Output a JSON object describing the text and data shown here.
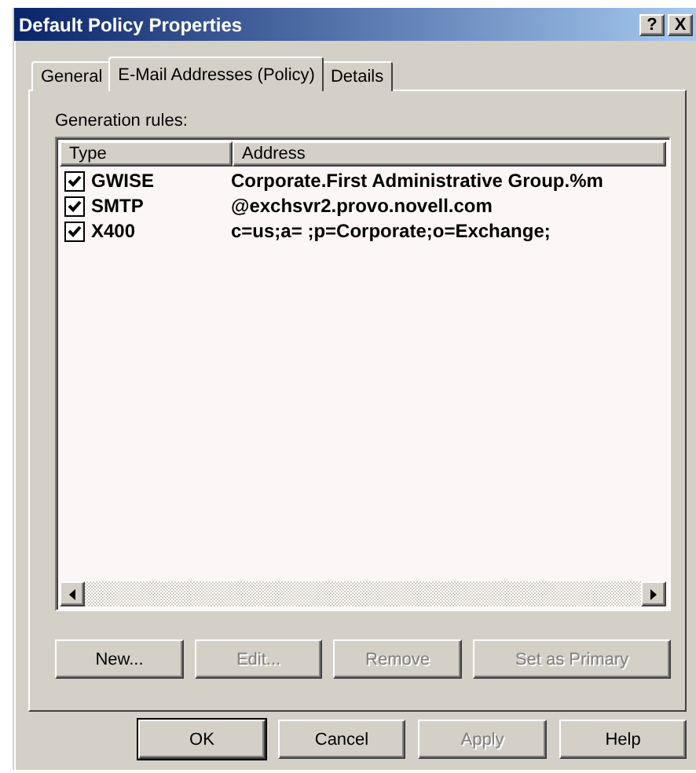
{
  "window": {
    "title": "Default Policy Properties",
    "title_buttons": [
      "?",
      "X"
    ]
  },
  "tabs": [
    {
      "label": "General",
      "selected": false
    },
    {
      "label": "E-Mail Addresses (Policy)",
      "selected": true
    },
    {
      "label": "Details",
      "selected": false
    }
  ],
  "generation_rules": {
    "label": "Generation rules:",
    "columns": [
      "Type",
      "Address"
    ],
    "rows": [
      {
        "type": "GWISE",
        "address": "Corporate.First Administrative Group.%m",
        "checked": true
      },
      {
        "type": "SMTP",
        "address": "@exchsvr2.provo.novell.com",
        "checked": true
      },
      {
        "type": "X400",
        "address": "c=us;a= ;p=Corporate;o=Exchange;",
        "checked": true
      }
    ]
  },
  "rule_buttons": [
    {
      "label": "New...",
      "disabled": false
    },
    {
      "label": "Edit...",
      "disabled": true
    },
    {
      "label": "Remove",
      "disabled": true
    },
    {
      "label": "Set as Primary",
      "disabled": true
    }
  ],
  "dialog_buttons": [
    {
      "label": "OK",
      "disabled": false,
      "default": true
    },
    {
      "label": "Cancel",
      "disabled": false,
      "default": false
    },
    {
      "label": "Apply",
      "disabled": true,
      "default": false
    },
    {
      "label": "Help",
      "disabled": false,
      "default": false
    }
  ]
}
